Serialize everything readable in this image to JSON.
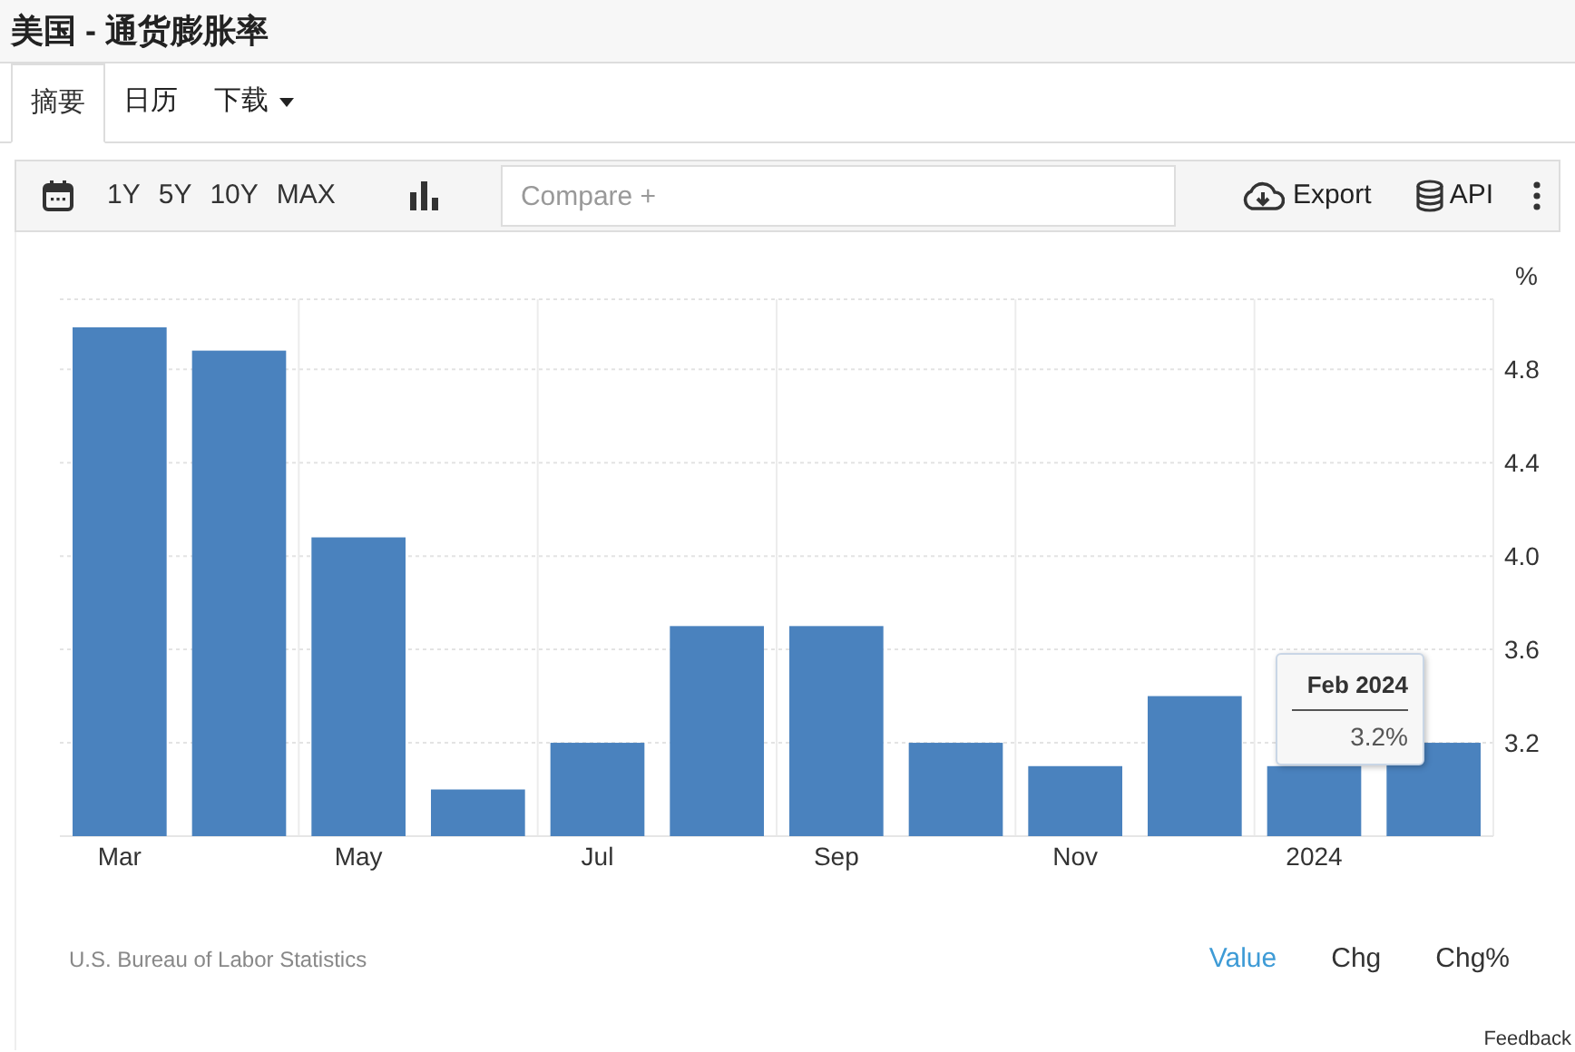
{
  "page_title": "美国 - 通货膨胀率",
  "tabs": [
    {
      "label": "摘要",
      "selected": true
    },
    {
      "label": "日历",
      "selected": false
    },
    {
      "label": "下载",
      "selected": false,
      "dropdown": true
    }
  ],
  "toolbar": {
    "ranges": [
      "1Y",
      "5Y",
      "10Y",
      "MAX"
    ],
    "compare": {
      "placeholder": "Compare +"
    },
    "export": "Export",
    "api": "API"
  },
  "chart": {
    "unit": "%",
    "chart_data": {
      "type": "bar",
      "grid": true,
      "ylim": [
        2.8,
        5.1
      ],
      "yticks": [
        3.2,
        3.6,
        {
          "value": 4,
          "label": "4.0"
        },
        4.4,
        4.8
      ],
      "categories": [
        "Mar",
        null,
        "May",
        null,
        "Jul",
        null,
        "Sep",
        null,
        "Nov",
        null,
        "2024",
        null
      ],
      "series": [
        {
          "color": "#4a82be",
          "values": [
            4.98,
            4.88,
            4.08,
            3.0,
            3.2,
            3.7,
            3.7,
            3.2,
            3.1,
            3.4,
            3.1,
            3.2
          ]
        }
      ]
    },
    "tooltip": {
      "title": "Feb 2024",
      "value": "3.2%"
    }
  },
  "source": "U.S. Bureau of Labor Statistics",
  "views": [
    {
      "label": "Value",
      "selected": true
    },
    {
      "label": "Chg",
      "selected": false
    },
    {
      "label": "Chg%",
      "selected": false
    }
  ],
  "feedback": "Feedback"
}
